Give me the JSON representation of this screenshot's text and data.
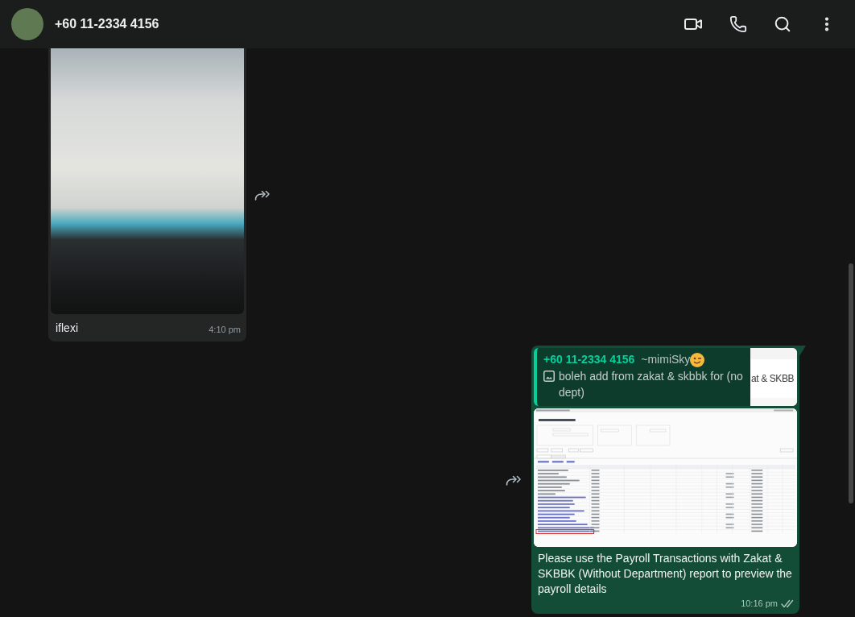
{
  "header": {
    "contact_name": "+60 11-2334 4156"
  },
  "messages": [
    {
      "kind": "incoming",
      "media": {
        "kind": "photo"
      },
      "caption": "iflexi",
      "time": "4:10 pm"
    },
    {
      "kind": "outgoing",
      "quote": {
        "author": "+60 11-2334 4156",
        "alias": "~mimiSky",
        "attachment": {
          "kind": "photo"
        },
        "text": "boleh add from zakat & skbbk for (no dept)",
        "thumbnail_text": "at & SKBB"
      },
      "media": {
        "kind": "screenshot"
      },
      "caption": "Please use the Payroll Transactions with Zakat & SKBBK (Without Department) report to preview the payroll details",
      "time": "10:16 pm",
      "read": false
    }
  ]
}
